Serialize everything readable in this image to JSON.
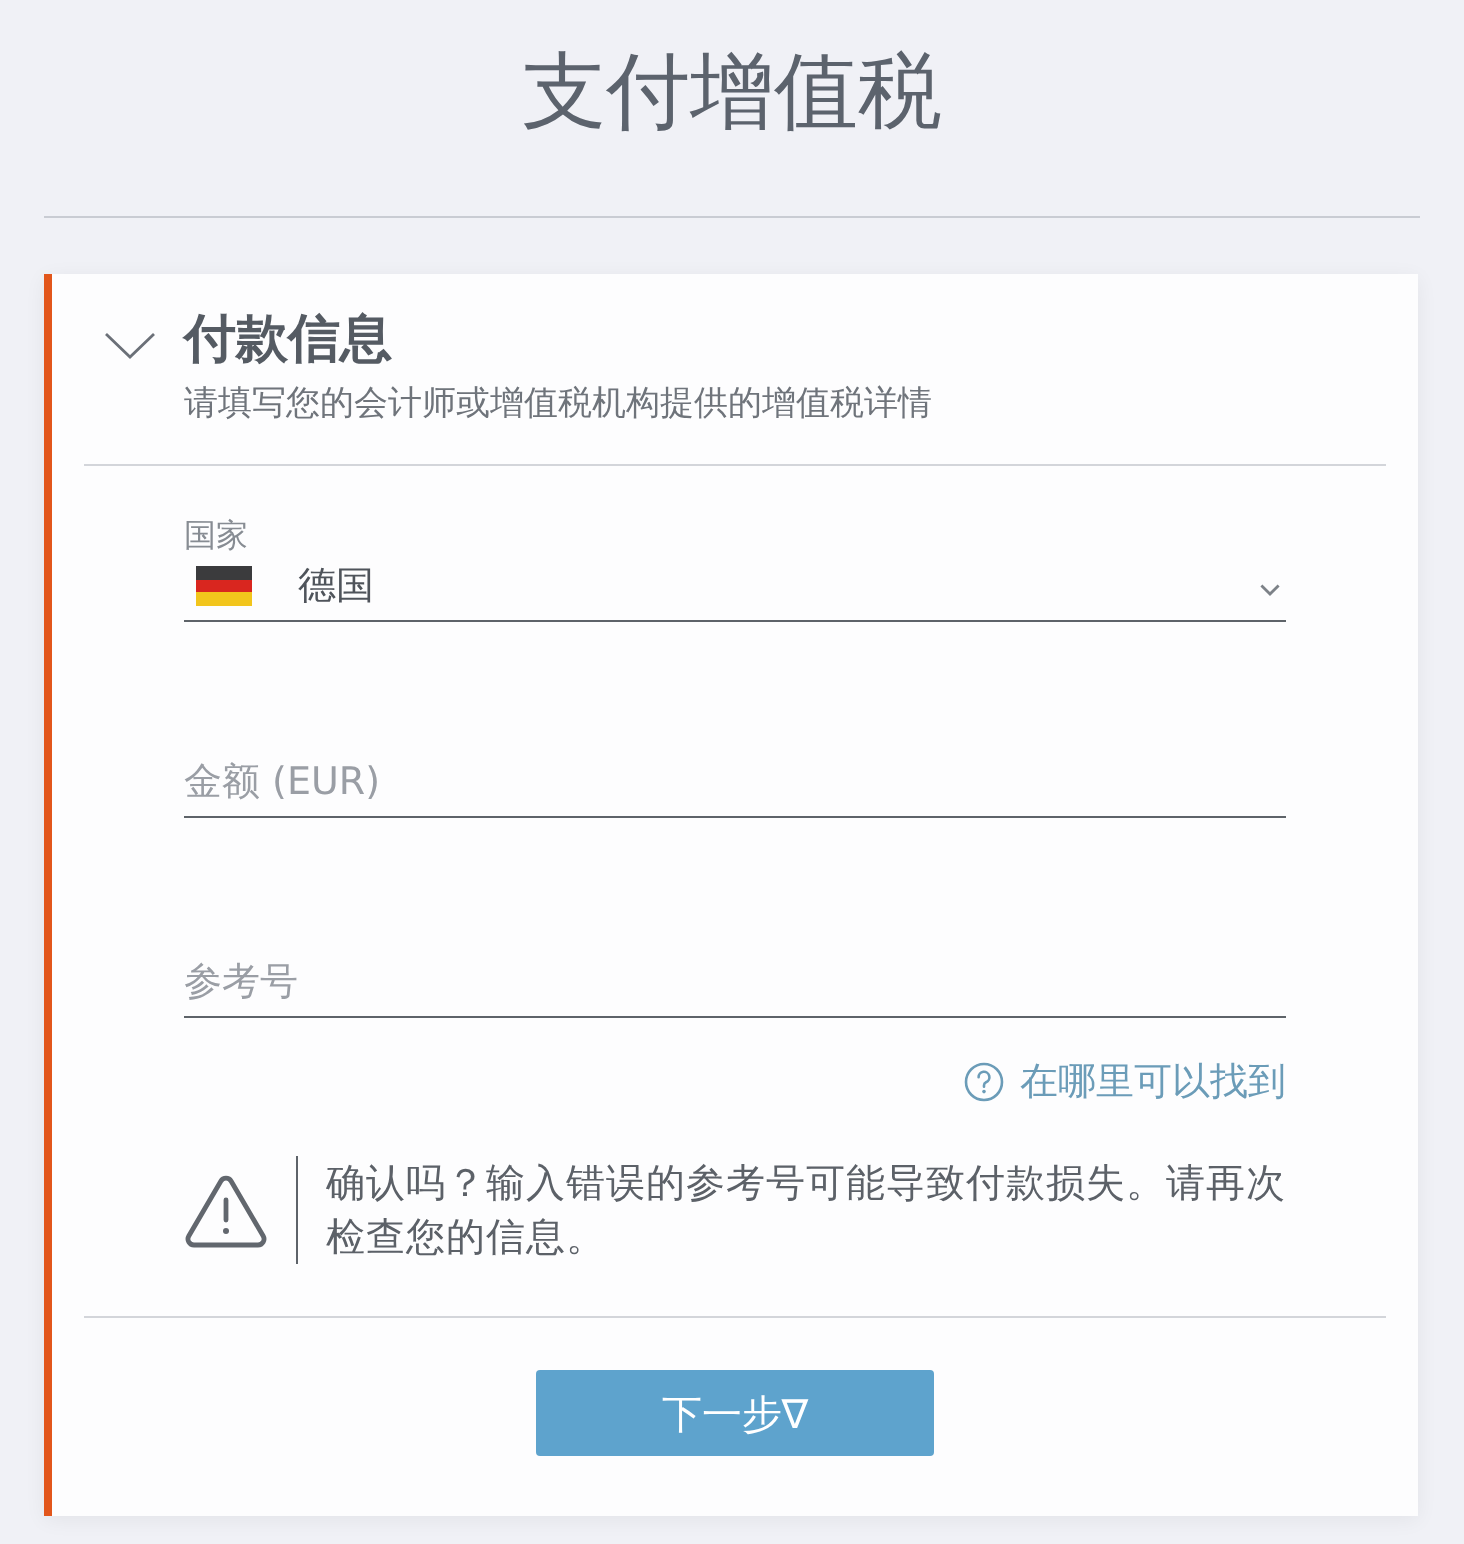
{
  "page": {
    "title": "支付增值税"
  },
  "section": {
    "title": "付款信息",
    "subtitle": "请填写您的会计师或增值税机构提供的增值税详情",
    "expanded": true
  },
  "fields": [
    {
      "kind": "select",
      "label": "国家",
      "value": "德国"
    },
    {
      "kind": "text",
      "placeholder": "金额 (EUR)"
    },
    {
      "kind": "text",
      "placeholder": "参考号"
    }
  ],
  "help_link": {
    "label": "在哪里可以找到"
  },
  "warning": {
    "text": "确认吗？输入错误的参考号可能导致付款损失。请再次检查您的信息。"
  },
  "buttons": [
    {
      "label": "下一步∇"
    }
  ]
}
